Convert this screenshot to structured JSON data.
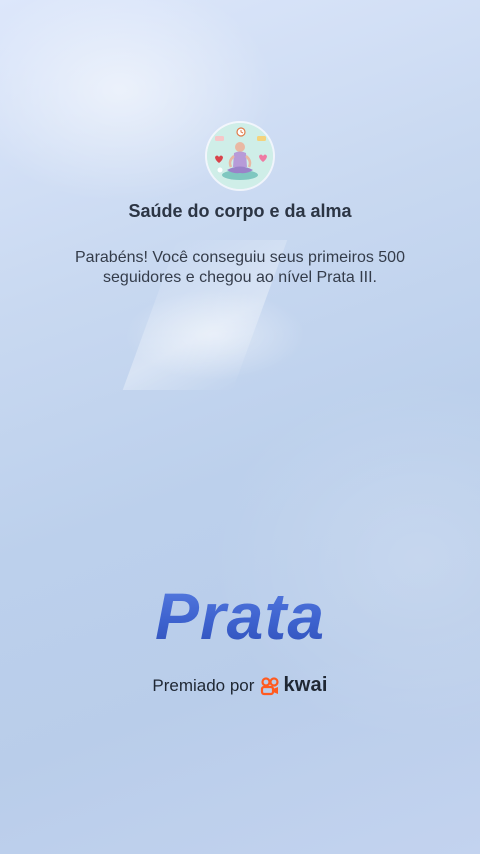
{
  "achievement": {
    "icon": "meditation-badge-icon",
    "title": "Saúde do corpo e da alma",
    "message": "Parabéns! Você conseguiu seus primeiros 500 seguidores e chegou ao nível Prata III.",
    "level": "Prata"
  },
  "footer": {
    "awarded_by_label": "Premiado por",
    "brand_icon": "kwai-logo-icon",
    "brand_name": "kwai"
  },
  "colors": {
    "level_text": "#3e63cf",
    "brand_orange": "#ff5a1f",
    "badge_bg": "#cfeee8"
  }
}
